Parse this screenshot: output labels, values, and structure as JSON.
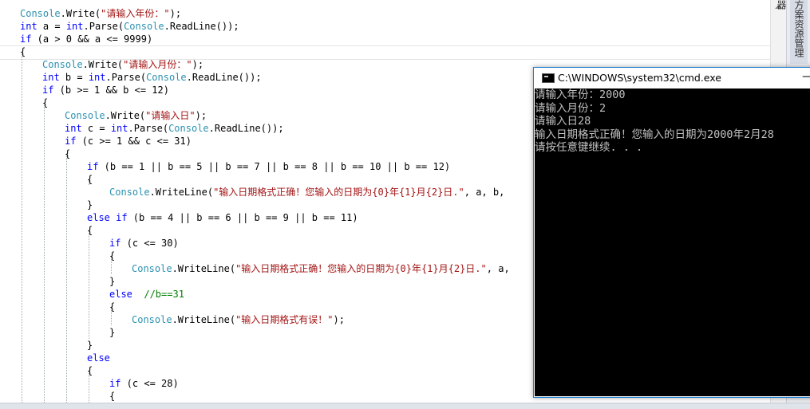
{
  "editor": {
    "lines": [
      {
        "indent": 0,
        "tokens": [
          [
            "ty",
            "Console"
          ],
          [
            "",
            "."
          ],
          [
            "",
            "Write("
          ],
          [
            "str",
            "\"请输入年份：\""
          ],
          [
            "",
            ");"
          ]
        ]
      },
      {
        "indent": 0,
        "tokens": [
          [
            "kw",
            "int"
          ],
          [
            "",
            " a = "
          ],
          [
            "kw",
            "int"
          ],
          [
            "",
            ".Parse("
          ],
          [
            "ty",
            "Console"
          ],
          [
            "",
            ".ReadLine());"
          ]
        ]
      },
      {
        "indent": 0,
        "tokens": [
          [
            "kw",
            "if"
          ],
          [
            "",
            " (a > 0 && a <= 9999)"
          ]
        ]
      },
      {
        "indent": 0,
        "tokens": [
          [
            "",
            "{"
          ]
        ]
      },
      {
        "indent": 1,
        "tokens": [
          [
            "ty",
            "Console"
          ],
          [
            "",
            ".Write("
          ],
          [
            "str",
            "\"请输入月份：\""
          ],
          [
            "",
            ");"
          ]
        ]
      },
      {
        "indent": 1,
        "tokens": [
          [
            "kw",
            "int"
          ],
          [
            "",
            " b = "
          ],
          [
            "kw",
            "int"
          ],
          [
            "",
            ".Parse("
          ],
          [
            "ty",
            "Console"
          ],
          [
            "",
            ".ReadLine());"
          ]
        ]
      },
      {
        "indent": 1,
        "tokens": [
          [
            "kw",
            "if"
          ],
          [
            "",
            " (b >= 1 && b <= 12)"
          ]
        ]
      },
      {
        "indent": 1,
        "tokens": [
          [
            "",
            "{"
          ]
        ]
      },
      {
        "indent": 2,
        "tokens": [
          [
            "ty",
            "Console"
          ],
          [
            "",
            ".Write("
          ],
          [
            "str",
            "\"请输入日\""
          ],
          [
            "",
            ");"
          ]
        ]
      },
      {
        "indent": 2,
        "tokens": [
          [
            "kw",
            "int"
          ],
          [
            "",
            " c = "
          ],
          [
            "kw",
            "int"
          ],
          [
            "",
            ".Parse("
          ],
          [
            "ty",
            "Console"
          ],
          [
            "",
            ".ReadLine());"
          ]
        ]
      },
      {
        "indent": 2,
        "tokens": [
          [
            "kw",
            "if"
          ],
          [
            "",
            " (c >= 1 && c <= 31)"
          ]
        ]
      },
      {
        "indent": 2,
        "tokens": [
          [
            "",
            "{"
          ]
        ]
      },
      {
        "indent": 3,
        "tokens": [
          [
            "kw",
            "if"
          ],
          [
            "",
            " (b == 1 || b == 5 || b == 7 || b == 8 || b == 10 || b == 12)"
          ]
        ]
      },
      {
        "indent": 3,
        "tokens": [
          [
            "",
            "{"
          ]
        ]
      },
      {
        "indent": 4,
        "tokens": [
          [
            "ty",
            "Console"
          ],
          [
            "",
            ".WriteLine("
          ],
          [
            "str",
            "\"输入日期格式正确！您输入的日期为{0}年{1}月{2}日.\""
          ],
          [
            "",
            ", a, b,"
          ]
        ]
      },
      {
        "indent": 3,
        "tokens": [
          [
            "",
            "}"
          ]
        ]
      },
      {
        "indent": 3,
        "tokens": [
          [
            "kw",
            "else if"
          ],
          [
            "",
            " (b == 4 || b == 6 || b == 9 || b == 11)"
          ]
        ]
      },
      {
        "indent": 3,
        "tokens": [
          [
            "",
            "{"
          ]
        ]
      },
      {
        "indent": 4,
        "tokens": [
          [
            "kw",
            "if"
          ],
          [
            "",
            " (c <= 30)"
          ]
        ]
      },
      {
        "indent": 4,
        "tokens": [
          [
            "",
            "{"
          ]
        ]
      },
      {
        "indent": 5,
        "tokens": [
          [
            "ty",
            "Console"
          ],
          [
            "",
            ".WriteLine("
          ],
          [
            "str",
            "\"输入日期格式正确！您输入的日期为{0}年{1}月{2}日.\""
          ],
          [
            "",
            ", a,"
          ]
        ]
      },
      {
        "indent": 4,
        "tokens": [
          [
            "",
            "}"
          ]
        ]
      },
      {
        "indent": 4,
        "tokens": [
          [
            "kw",
            "else"
          ],
          [
            "",
            "  "
          ],
          [
            "cm",
            "//b==31"
          ]
        ]
      },
      {
        "indent": 4,
        "tokens": [
          [
            "",
            "{"
          ]
        ]
      },
      {
        "indent": 5,
        "tokens": [
          [
            "ty",
            "Console"
          ],
          [
            "",
            ".WriteLine("
          ],
          [
            "str",
            "\"输入日期格式有误！\""
          ],
          [
            "",
            ");"
          ]
        ]
      },
      {
        "indent": 4,
        "tokens": [
          [
            "",
            "}"
          ]
        ]
      },
      {
        "indent": 3,
        "tokens": [
          [
            "",
            "}"
          ]
        ]
      },
      {
        "indent": 3,
        "tokens": [
          [
            "kw",
            "else"
          ]
        ]
      },
      {
        "indent": 3,
        "tokens": [
          [
            "",
            "{"
          ]
        ]
      },
      {
        "indent": 4,
        "tokens": [
          [
            "kw",
            "if"
          ],
          [
            "",
            " (c <= 28)"
          ]
        ]
      },
      {
        "indent": 4,
        "tokens": [
          [
            "",
            "{"
          ]
        ]
      }
    ]
  },
  "side_panel": {
    "tab_label": "方案资源管理器"
  },
  "cmd_window": {
    "title": "C:\\WINDOWS\\system32\\cmd.exe",
    "minimize_glyph": "—",
    "output_lines": [
      "请输入年份：2000",
      "请输入月份：2",
      "请输入日28",
      "输入日期格式正确！您输入的日期为2000年2月28",
      "请按任意键继续. . ."
    ]
  },
  "colors": {
    "keyword": "#0000ff",
    "type": "#2b91af",
    "string": "#a31515",
    "comment": "#008000",
    "console_bg": "#000000",
    "console_fg": "#c0c0c0",
    "window_border": "#1e7fd0"
  }
}
